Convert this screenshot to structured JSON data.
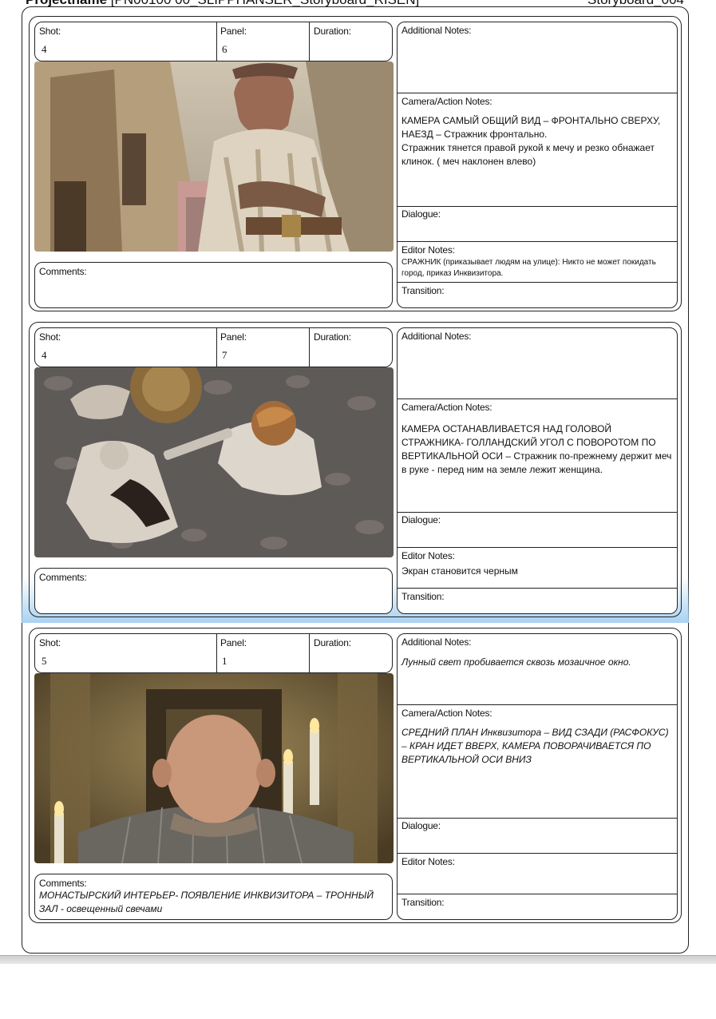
{
  "header": {
    "project_label": "Projectname",
    "project_value": "[PN00100 00_SLIPPHANSER_Storyboard_RISEN]",
    "storyboard_id": "Storyboard_004"
  },
  "labels": {
    "shot": "Shot:",
    "panel": "Panel:",
    "duration": "Duration:",
    "comments": "Comments:",
    "additional_notes": "Additional Notes:",
    "camera_notes": "Camera/Action Notes:",
    "dialogue": "Dialogue:",
    "editor_notes": "Editor Notes:",
    "transition": "Transition:"
  },
  "panels": [
    {
      "shot": "4",
      "panel": "6",
      "duration": "",
      "comments": "",
      "additional_notes": "",
      "camera_notes": "КАМЕРА САМЫЙ ОБЩИЙ ВИД – ФРОНТАЛЬНО СВЕРХУ, НАЕЗД – Стражник фронтально.\nСтражник тянется правой рукой к мечу и резко обнажает клинок. ( меч наклонен влево)",
      "dialogue": "",
      "editor_notes": "СРАЖНИК (приказывает людям на улице): Никто не может покидать город, приказ Инквизитора.",
      "transition": "",
      "image_icon": "guard-illustration"
    },
    {
      "shot": "4",
      "panel": "7",
      "duration": "",
      "comments": "",
      "additional_notes": "",
      "camera_notes": "КАМЕРА ОСТАНАВЛИВАЕТСЯ НАД ГОЛОВОЙ СТРАЖНИКА- ГОЛЛАНДСКИЙ УГОЛ С ПОВОРОТОМ ПО ВЕРТИКАЛЬНОЙ ОСИ – Стражник по-прежнему держит меч в руке - перед ним на земле лежит женщина.",
      "dialogue": "",
      "editor_notes": "Экран становится черным",
      "transition": "",
      "image_icon": "overhead-street-illustration"
    },
    {
      "shot": "5",
      "panel": "1",
      "duration": "",
      "comments": "МОНАСТЫРСКИЙ ИНТЕРЬЕР- ПОЯВЛЕНИЕ ИНКВИЗИТОРА – ТРОННЫЙ ЗАЛ - освещенный свечами",
      "additional_notes": "Лунный свет пробивается сквозь мозаичное окно.",
      "camera_notes": "СРЕДНИЙ ПЛАН Инквизитора – ВИД СЗАДИ (РАСФОКУС) – КРАН ИДЕТ ВВЕРХ, КАМЕРА ПОВОРАЧИВАЕТСЯ ПО ВЕРТИКАЛЬНОЙ ОСИ ВНИЗ",
      "dialogue": "",
      "editor_notes": "",
      "transition": "",
      "image_icon": "inquisitor-illustration"
    }
  ]
}
